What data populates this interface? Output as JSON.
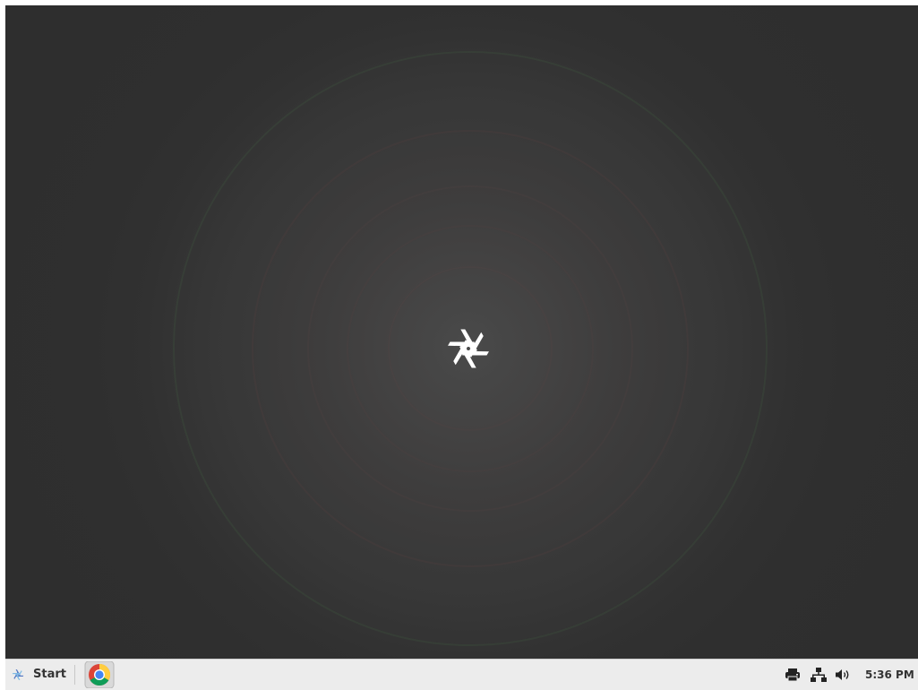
{
  "desktop": {
    "background_color": "#2e2e2e",
    "logo_icon": "nixos-snowflake-icon",
    "logo_color": "#ffffff"
  },
  "taskbar": {
    "start": {
      "label": "Start",
      "icon": "nixos-snowflake-icon",
      "icon_color": "#5277c3"
    },
    "tasks": [
      {
        "icon": "chrome-icon"
      }
    ],
    "tray": {
      "icons": [
        "printer-icon",
        "network-icon",
        "volume-icon"
      ],
      "clock": "5:36 PM"
    }
  }
}
